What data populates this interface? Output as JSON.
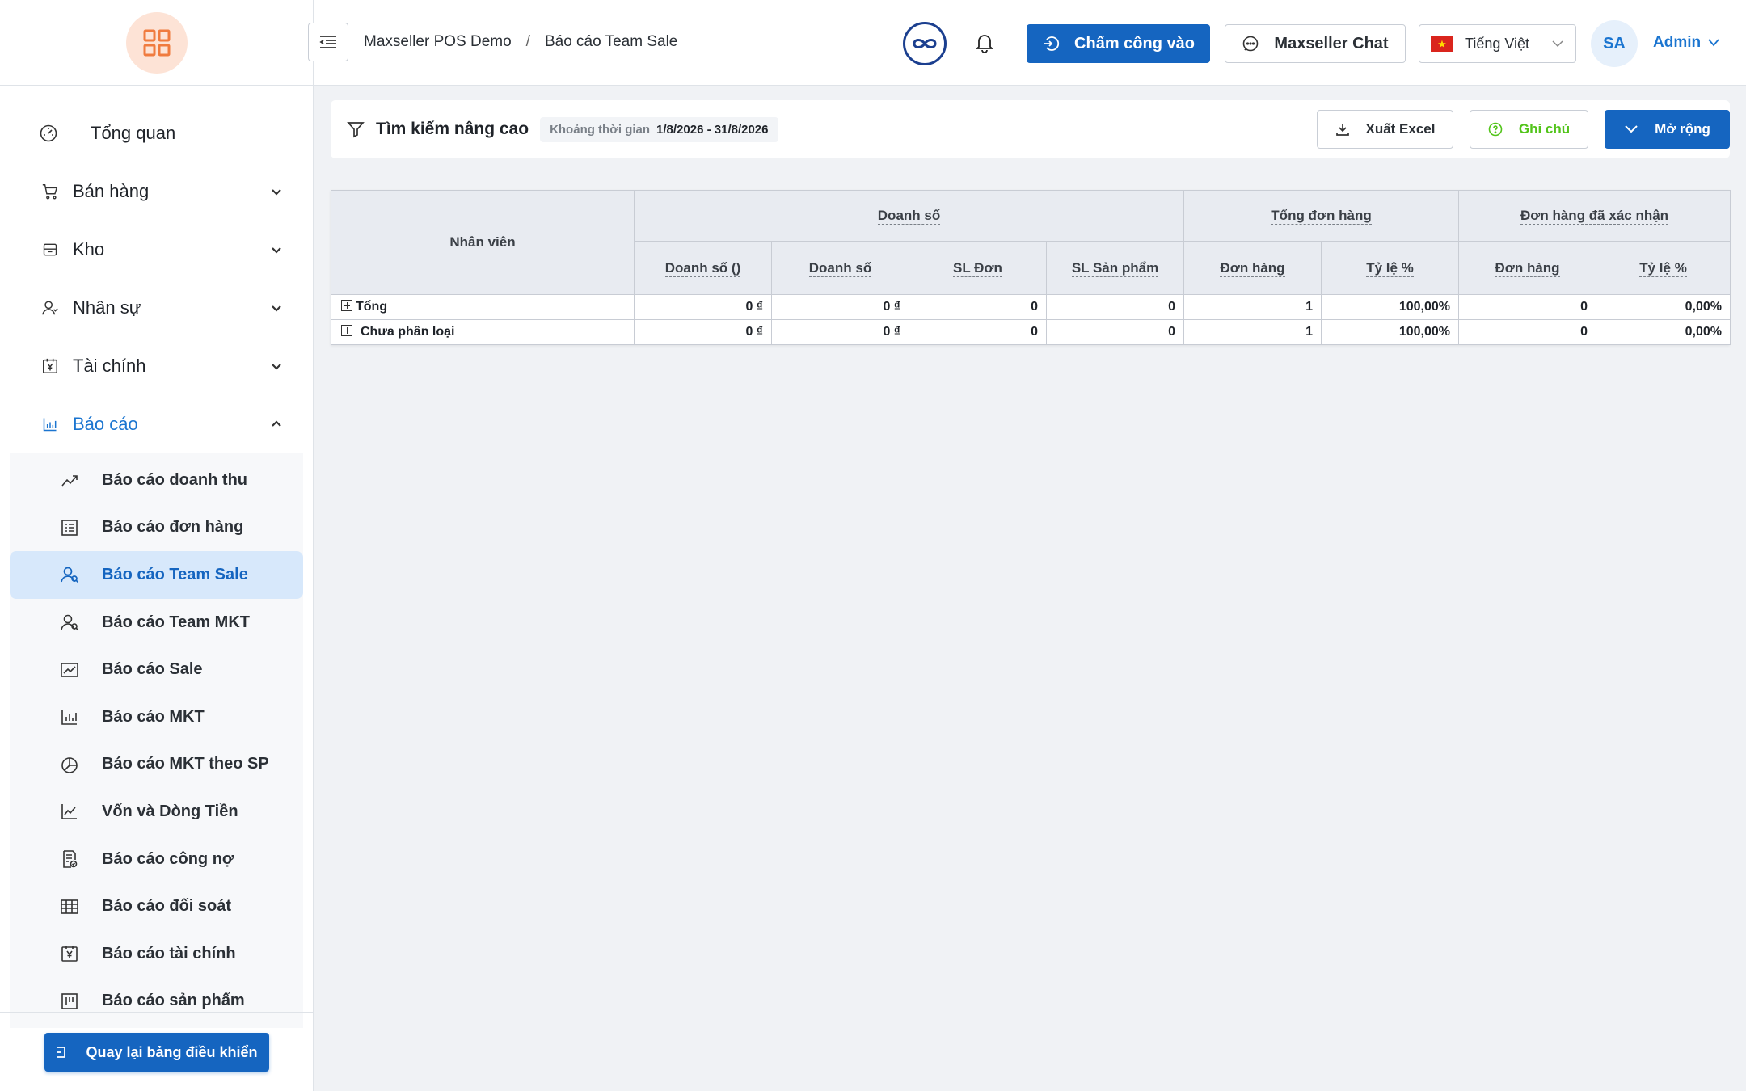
{
  "sidebar": {
    "items": [
      {
        "label": "Tổng quan",
        "icon": "dashboard-gauge-icon"
      },
      {
        "label": "Bán hàng",
        "icon": "cart-icon"
      },
      {
        "label": "Kho",
        "icon": "box-icon"
      },
      {
        "label": "Nhân sự",
        "icon": "user-icon"
      },
      {
        "label": "Tài chính",
        "icon": "calendar-yen-icon"
      },
      {
        "label": "Báo cáo",
        "icon": "bar-chart-icon"
      }
    ],
    "report_items": [
      {
        "label": "Báo cáo doanh thu",
        "icon": "trend-line-icon"
      },
      {
        "label": "Báo cáo đơn hàng",
        "icon": "list-doc-icon"
      },
      {
        "label": "Báo cáo Team Sale",
        "icon": "users-icon"
      },
      {
        "label": "Báo cáo Team MKT",
        "icon": "users-icon"
      },
      {
        "label": "Báo cáo Sale",
        "icon": "area-chart-icon"
      },
      {
        "label": "Báo cáo MKT",
        "icon": "bar-chart-icon"
      },
      {
        "label": "Báo cáo MKT theo SP",
        "icon": "pie-chart-icon"
      },
      {
        "label": "Vốn và Dòng Tiền",
        "icon": "line-chart-icon"
      },
      {
        "label": "Báo cáo công nợ",
        "icon": "doc-badge-icon"
      },
      {
        "label": "Báo cáo đối soát",
        "icon": "table-grid-icon"
      },
      {
        "label": "Báo cáo tài chính",
        "icon": "calendar-yen-icon"
      },
      {
        "label": "Báo cáo sản phẩm",
        "icon": "product-board-icon"
      }
    ],
    "back_button": "Quay lại bảng điều khiển"
  },
  "header": {
    "breadcrumb": [
      "Maxseller POS Demo",
      "/",
      "Báo cáo Team Sale"
    ],
    "checkin_label": "Chấm công vào",
    "chat_label": "Maxseller Chat",
    "language": "Tiếng Việt",
    "avatar_initials": "SA",
    "user_name": "Admin"
  },
  "filter": {
    "title": "Tìm kiếm nâng cao",
    "date_label": "Khoảng thời gian",
    "date_value": "1/8/2026 - 31/8/2026",
    "export_label": "Xuất Excel",
    "note_label": "Ghi chú",
    "expand_label": "Mở rộng"
  },
  "table": {
    "employee_header": "Nhân viên",
    "groups": [
      "Doanh số",
      "Tổng đơn hàng",
      "Đơn hàng đã xác nhận"
    ],
    "columns": [
      "Doanh số ()",
      "Doanh số",
      "SL Đơn",
      "SL Sản phẩm",
      "Đơn hàng",
      "Tỷ lệ %",
      "Đơn hàng",
      "Tỷ lệ %"
    ],
    "rows": [
      {
        "name": "Tổng",
        "values": [
          "0 ₫",
          "0 ₫",
          "0",
          "0",
          "1",
          "100,00%",
          "0",
          "0,00%"
        ]
      },
      {
        "name": "Chưa phân loại",
        "values": [
          "0 ₫",
          "0 ₫",
          "0",
          "0",
          "1",
          "100,00%",
          "0",
          "0,00%"
        ]
      }
    ]
  },
  "colors": {
    "primary": "#1565c0",
    "active_text": "#1b75d0",
    "note_green": "#52c41a",
    "logo_bg": "#fde3d6",
    "logo_fg": "#f07b3f"
  }
}
